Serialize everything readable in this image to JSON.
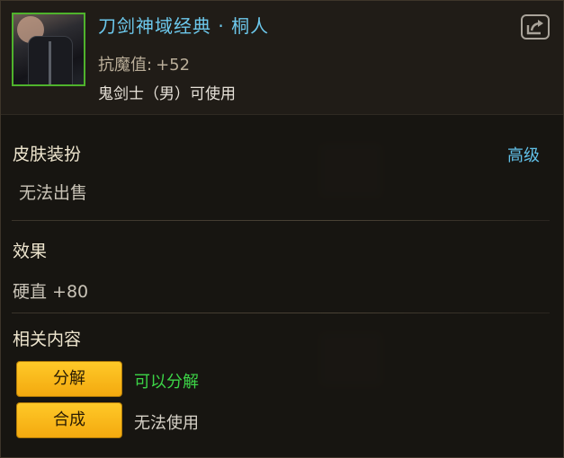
{
  "item": {
    "name": "刀剑神域经典 · 桐人",
    "stat_label": "抗魔值:",
    "stat_value": "+52",
    "requirement": "鬼剑士（男）可使用",
    "grade": "高级"
  },
  "sections": {
    "skin_title": "皮肤装扮",
    "sell_status": "无法出售",
    "effect_title": "效果",
    "effect_value": "硬直 +80",
    "related_title": "相关内容"
  },
  "actions": [
    {
      "label": "分解",
      "note": "可以分解"
    },
    {
      "label": "合成",
      "note": "无法使用"
    }
  ],
  "icons": {
    "share": "share-external-icon"
  },
  "colors": {
    "name": "#6cc8ec",
    "grade": "#61c0e8",
    "button": "#ffc928",
    "ok": "#3cd447",
    "frame": "#4fb32c"
  }
}
